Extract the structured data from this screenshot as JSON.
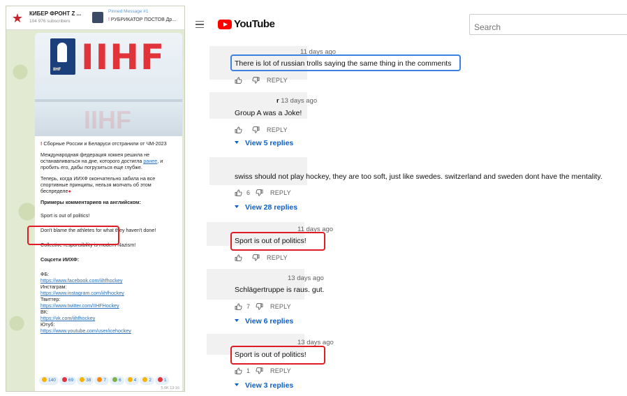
{
  "telegram": {
    "channel_title": "КИБЕР ФРОНТ Z ...",
    "subscribers": "104 976 subscribers",
    "pinned_title": "Pinned Message #1",
    "pinned_text": "РУБРИКАТОР ПОСТОВ Др...",
    "image_text": "IIHF",
    "image_logo_small": "IIHF",
    "headline": "Сборные России и Беларуси отстранили от ЧМ-2023",
    "para1_a": "Международная федерация хоккея решила не останавливаться на дне, которого достигла ",
    "para1_link": "ранее",
    "para1_b": ", и пробить его, дабы погрузиться еще глубже.",
    "para2": "Теперь, когда ИИХФ окончательно забила на все спортивные принципы, нельзя молчать об этом беспределе",
    "examples_label": "Примеры комментариев на английском:",
    "quote1": "Sport is out of politics!",
    "quote2": "Don't blame the athletes for what they haven't done!",
    "quote3": "Collective responsibility is modern Nazism!",
    "socials_label": "Соцсети ИИХФ:",
    "fb_label": "ФБ:",
    "fb_link": "https://www.facebook.com/iihfhockey",
    "ig_label": "Инстаграм:",
    "ig_link": "https://www.instagram.com/iihfhockey",
    "tw_label": "Твиттер:",
    "tw_link": "https://www.twitter.com/IIHFHockey",
    "vk_label": "ВК:",
    "vk_link": "https://vk.com/iihfhockey",
    "yt_label": "Ютуб:",
    "yt_link": "https://www.youtube.com/user/icehockey",
    "reactions": [
      {
        "count": "140",
        "color": "#f5b400"
      },
      {
        "count": "69",
        "color": "#e0343a"
      },
      {
        "count": "38",
        "color": "#f5b400"
      },
      {
        "count": "7",
        "color": "#ff8a00"
      },
      {
        "count": "6",
        "color": "#7cb342"
      },
      {
        "count": "4",
        "color": "#f5b400"
      },
      {
        "count": "2",
        "color": "#f5b400"
      },
      {
        "count": "1",
        "color": "#e0343a"
      }
    ],
    "meta": "5.6K 13:16"
  },
  "youtube": {
    "logo_text": "YouTube",
    "search_placeholder": "Search",
    "reply_label": "REPLY",
    "comments": [
      {
        "time": "11 days ago",
        "author": "",
        "text": "There is lot of russian trolls saying the same thing in the comments",
        "likes": "",
        "replies": ""
      },
      {
        "time": "13 days ago",
        "author": "r",
        "text": "Group A was a Joke!",
        "likes": "",
        "replies": "View 5 replies"
      },
      {
        "time": "",
        "author": "",
        "text": "swiss should not play hockey, they are too soft, just like swedes. switzerland and sweden dont have the mentality.",
        "likes": "6",
        "replies": "View 28 replies"
      },
      {
        "time": "11 days ago",
        "author": "",
        "text": "Sport is out of politics!",
        "likes": "",
        "replies": ""
      },
      {
        "time": "13 days ago",
        "author": "",
        "text": "Schlägertruppe is raus. gut.",
        "likes": "7",
        "replies": "View 6 replies"
      },
      {
        "time": "13 days ago",
        "author": "",
        "text": "Sport is out of politics!",
        "likes": "1",
        "replies": "View 3 replies"
      }
    ]
  },
  "colors": {
    "highlight_red": "#e01b24",
    "highlight_blue": "#3b82e0",
    "youtube_red": "#ff0000",
    "link_blue": "#065fd4"
  }
}
